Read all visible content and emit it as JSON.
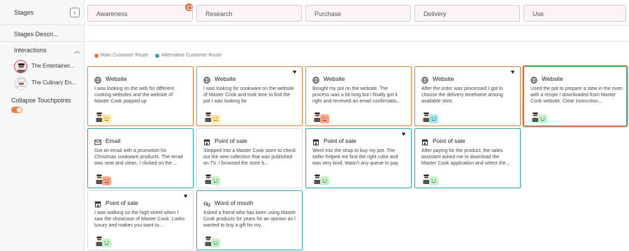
{
  "sidebar": {
    "stages_label": "Stages",
    "collapse_icon": "chevron-left-icon",
    "stages_description_label": "Stages Descri...",
    "interactions_label": "Interactions",
    "personas": [
      {
        "name": "The Entertainer..."
      },
      {
        "name": "The Culinary En..."
      }
    ],
    "collapse_touchpoints_label": "Collapse Touchpoints",
    "collapse_touchpoints_on": true
  },
  "stages": [
    "Awareness",
    "Research",
    "Purchase",
    "Delivery",
    "Use"
  ],
  "legend": {
    "main_route": "Main Customer Route",
    "alternative_route": "Alternative Customer Route",
    "main_color": "#e87a36",
    "alternative_color": "#2aa7ad"
  },
  "cards": [
    {
      "title": "Website",
      "icon": "globe-icon",
      "text": "I was looking on the web for different cooking websites and the website of Master Cook popped up",
      "emotion": "neutral",
      "route": "orange",
      "favorite": false
    },
    {
      "title": "Website",
      "icon": "globe-icon",
      "text": "I was looking for cookware on the website of Master Cook and took time to find the pot I was looking for",
      "emotion": "neutral",
      "route": "orange",
      "favorite": true
    },
    {
      "title": "Website",
      "icon": "globe-icon",
      "text": "Bought my pot on the website. The process was a bit long but I finally got it right and received an email confirmatio...",
      "emotion": "sad",
      "route": "orange",
      "favorite": false
    },
    {
      "title": "Website",
      "icon": "globe-icon",
      "text": "After the order was processed I got to choose the delivery timeframe among available slots",
      "emotion": "cool",
      "route": "orange",
      "favorite": true
    },
    {
      "title": "Website",
      "icon": "globe-icon",
      "text": "Used the pot to prepare a stew in the oven with a recipe I downloaded from Master Cook website. Clear instruction...",
      "emotion": "happy",
      "route": "both",
      "favorite": false
    },
    {
      "title": "Email",
      "icon": "mail-icon",
      "text": "Got an email with a promotion for Christmas cookware products. The email was neat and clean, I clicked on the ...",
      "emotion": "sad",
      "route": "teal",
      "favorite": false
    },
    {
      "title": "Point of sale",
      "icon": "store-icon",
      "text": "Stepped into a Master Cook store to check out the new collection that was published on TV. I browsed the store b...",
      "emotion": "happy",
      "route": "none",
      "favorite": false
    },
    {
      "title": "Point of sale",
      "icon": "store-icon",
      "text": "Went into the shop to buy my pot. The seller helped me find the right color and was very kind. Wasn't any queue to pay",
      "emotion": "happy",
      "route": "teal",
      "favorite": true
    },
    {
      "title": "Point of sale",
      "icon": "store-icon",
      "text": "After paying for the product, the sales assistant asked me to download the Master Cook application and select the...",
      "emotion": "happy",
      "route": "teal",
      "favorite": false
    },
    {
      "title": "Point of sale",
      "icon": "store-icon",
      "text": "I was walking on the high street when I saw the showcase of Master Cook. Looks luxury and makes you want to...",
      "emotion": "happy",
      "route": "none",
      "favorite": true
    },
    {
      "title": "Word of mouth",
      "icon": "speech-icon",
      "text": "Asked a friend who has been using Master Cook products for years for an opinion as I wanted to buy a gift for my...",
      "emotion": "happy",
      "route": "teal",
      "favorite": false
    }
  ]
}
